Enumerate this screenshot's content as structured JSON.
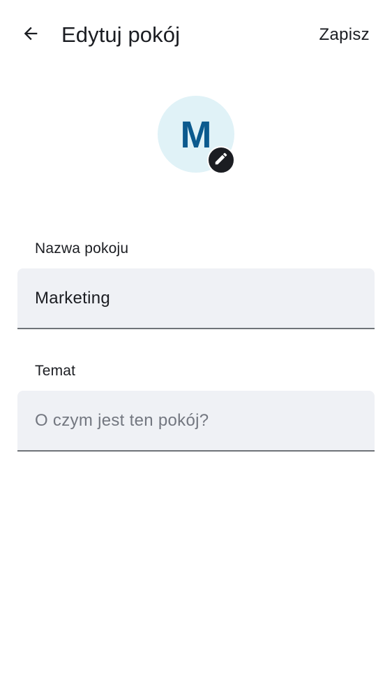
{
  "header": {
    "title": "Edytuj pokój",
    "save_label": "Zapisz"
  },
  "avatar": {
    "letter": "M",
    "background_color": "#e0f2f7",
    "letter_color": "#0b5a8e"
  },
  "form": {
    "name": {
      "label": "Nazwa pokoju",
      "value": "Marketing",
      "placeholder": ""
    },
    "topic": {
      "label": "Temat",
      "value": "",
      "placeholder": "O czym jest ten pokój?"
    }
  },
  "icons": {
    "back": "arrow-left-icon",
    "edit": "pencil-icon"
  }
}
